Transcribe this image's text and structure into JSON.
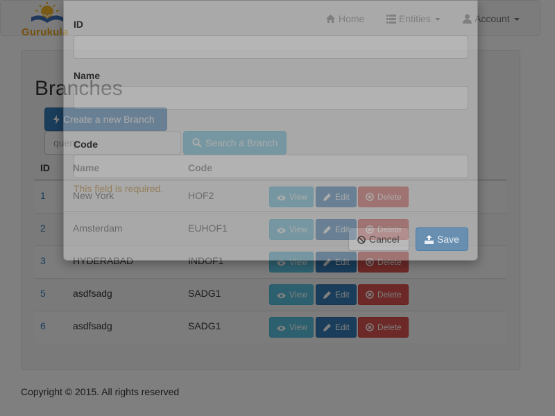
{
  "navbar": {
    "brand": "Gurukula",
    "items": [
      {
        "label": "Home",
        "icon": "home-icon"
      },
      {
        "label": "Entities",
        "icon": "entities-icon",
        "dropdown": true
      },
      {
        "label": "Account",
        "icon": "user-icon",
        "dropdown": true
      }
    ]
  },
  "page": {
    "title": "Branches",
    "create_button": "Create a new Branch",
    "search_placeholder": "query",
    "search_button": "Search a Branch",
    "columns": [
      "ID",
      "Name",
      "Code"
    ],
    "rows": [
      {
        "id": "1",
        "name": "New York",
        "code": "HOF2"
      },
      {
        "id": "2",
        "name": "Amsterdam",
        "code": "EUHOF1"
      },
      {
        "id": "3",
        "name": "HYDERABAD",
        "code": "INDOF1"
      },
      {
        "id": "5",
        "name": "asdfsadg",
        "code": "SADG1"
      },
      {
        "id": "6",
        "name": "asdfsadg",
        "code": "SADG1"
      }
    ],
    "row_actions": {
      "view": "View",
      "edit": "Edit",
      "delete": "Delete"
    }
  },
  "footer": "Copyright © 2015. All rights reserved",
  "modal": {
    "fields": [
      {
        "label": "ID",
        "value": ""
      },
      {
        "label": "Name",
        "value": ""
      },
      {
        "label": "Code",
        "value": ""
      }
    ],
    "error": "This field is required.",
    "cancel_button": "Cancel",
    "save_button": "Save"
  },
  "colors": {
    "primary": "#337ab7",
    "info": "#5bc0de",
    "danger": "#d9534f",
    "brand": "#e8a21b"
  }
}
